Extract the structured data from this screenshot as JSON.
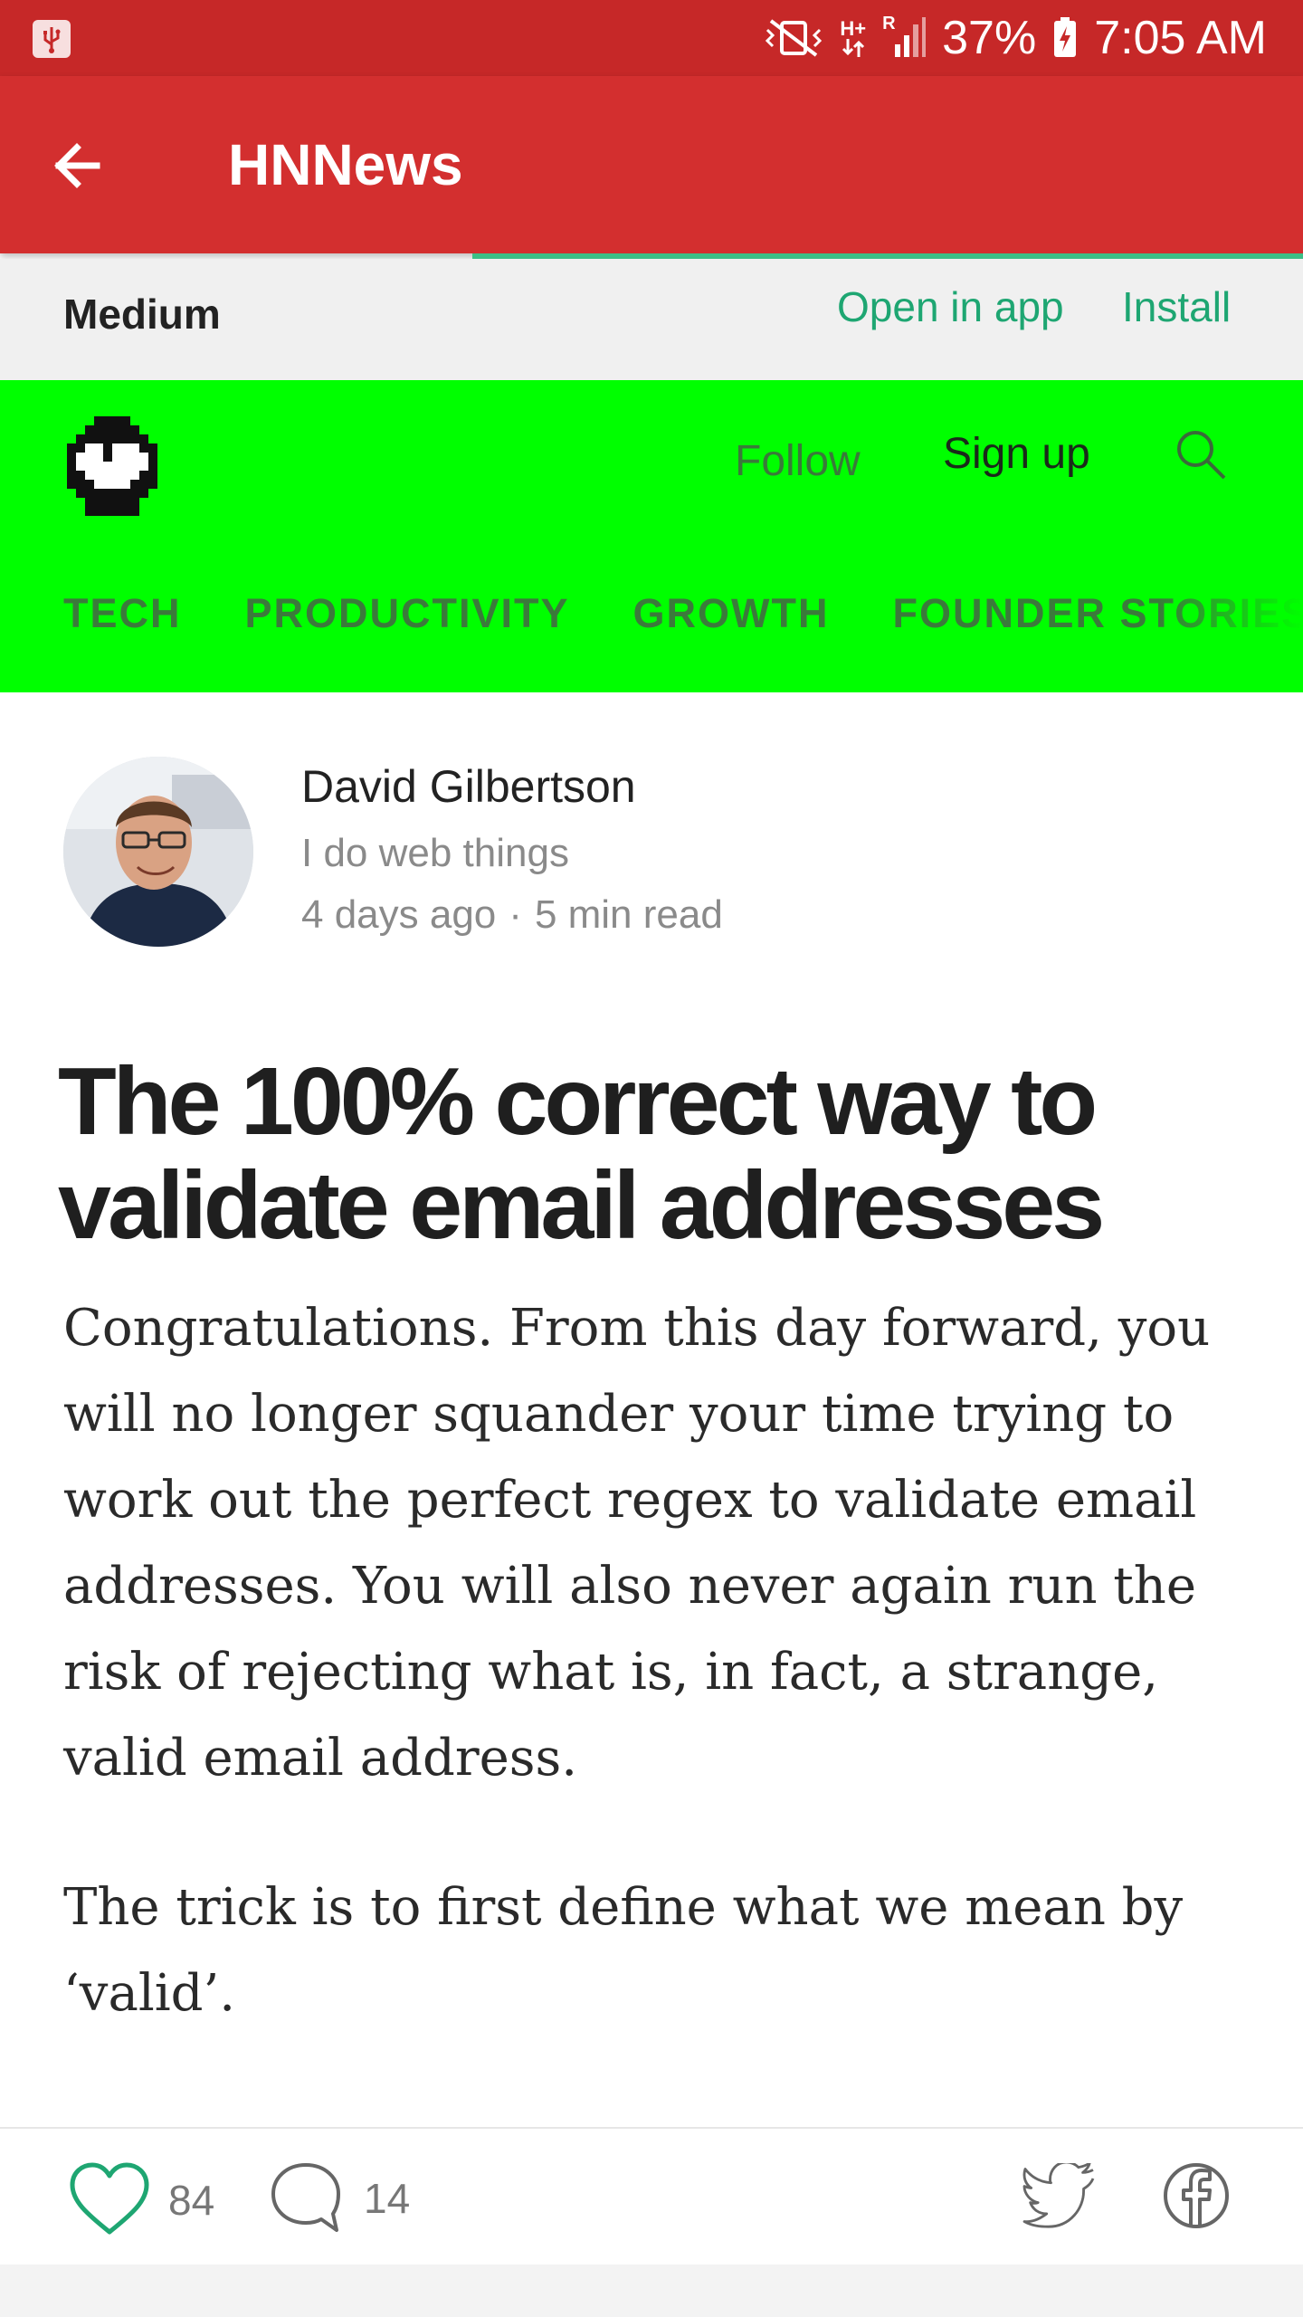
{
  "status_bar": {
    "battery": "37%",
    "time": "7:05 AM",
    "network_label": "H+",
    "roaming_label": "R",
    "icons": [
      "usb-icon",
      "mute-vibrate-icon",
      "data-arrows-icon",
      "signal-icon",
      "battery-charging-icon"
    ]
  },
  "app_bar": {
    "title": "HNNews",
    "back_icon": "arrow-left-icon"
  },
  "medium_bar": {
    "brand": "Medium",
    "open_in_app": "Open in app",
    "install": "Install"
  },
  "publication": {
    "follow": "Follow",
    "sign_up": "Sign up",
    "nav": [
      "TECH",
      "PRODUCTIVITY",
      "GROWTH",
      "FOUNDER STORIES"
    ],
    "background_color": "#00ff00"
  },
  "author": {
    "name": "David Gilbertson",
    "bio": "I do web things",
    "date": "4 days ago",
    "separator": "·",
    "read_time": "5 min read"
  },
  "article": {
    "title": "The 100% correct way to validate email addresses",
    "paragraphs": [
      "Congratulations. From this day forward, you will no longer squander your time trying to work out the perfect regex to validate email addresses. You will also never again run the risk of rejecting what is, in fact, a strange, valid email address.",
      "The trick is to first define what we mean by ‘valid’."
    ]
  },
  "actions": {
    "likes": "84",
    "comments": "14",
    "accent_color": "#1ea672"
  }
}
